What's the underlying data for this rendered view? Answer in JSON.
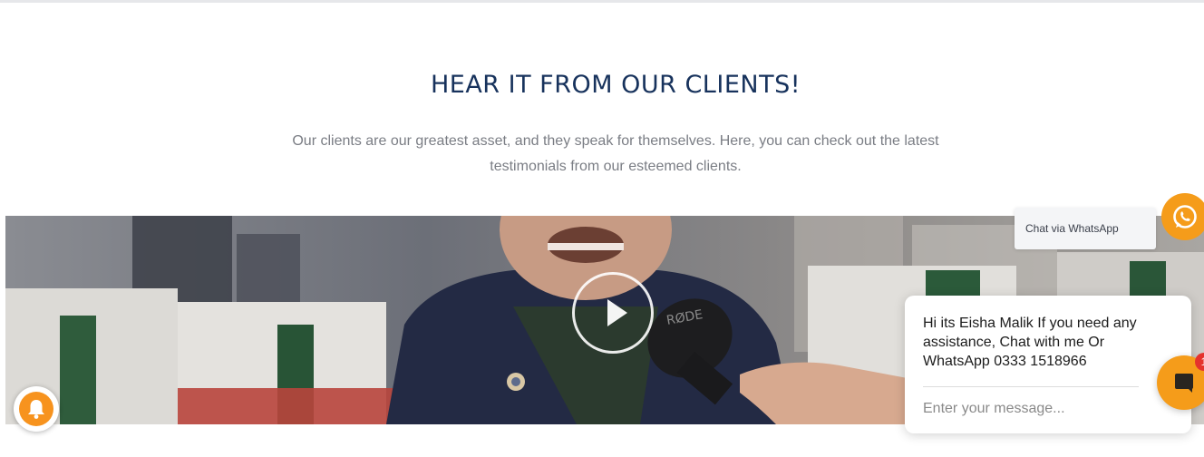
{
  "section": {
    "title": "HEAR IT FROM OUR CLIENTS!",
    "subtitle_line1": "Our clients are our greatest asset, and they speak for themselves. Here, you can check out the latest",
    "subtitle_line2": "testimonials from our esteemed clients."
  },
  "video": {
    "play_icon": "play-icon",
    "mic_brand": "RØDE"
  },
  "notifications": {
    "icon": "bell-icon"
  },
  "whatsapp": {
    "label": "Chat via WhatsApp",
    "icon": "whatsapp-icon"
  },
  "chat": {
    "message": "Hi its Eisha Malik If you need any assistance, Chat with me Or WhatsApp 0333 1518966",
    "placeholder": "Enter your message...",
    "unread_count": "1",
    "icon": "chat-bubble-icon"
  },
  "colors": {
    "heading": "#17325c",
    "accent": "#f59c1a",
    "badge": "#e5322d"
  }
}
